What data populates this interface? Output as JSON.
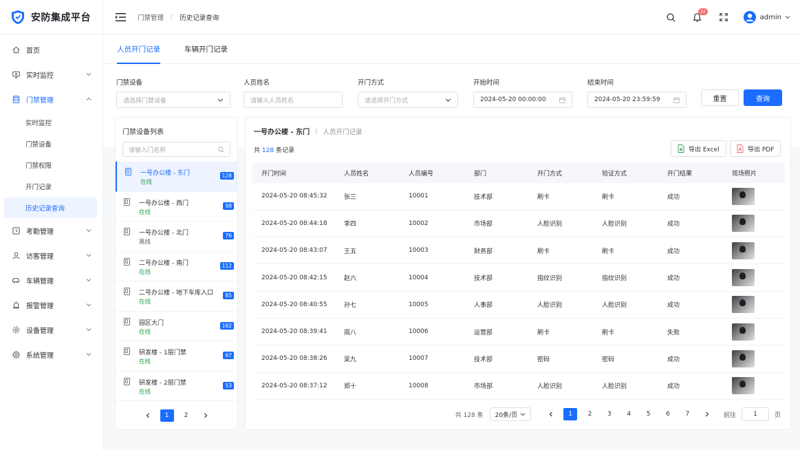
{
  "app": {
    "name": "安防集成平台"
  },
  "sidebar": {
    "items": [
      {
        "label": "首页",
        "icon": "home-icon"
      },
      {
        "label": "实时监控",
        "icon": "monitor-icon",
        "expandable": true
      },
      {
        "label": "门禁管理",
        "icon": "access-icon",
        "expandable": true,
        "open": true,
        "children": [
          "实时监控",
          "门禁设备",
          "门禁权限",
          "开门记录",
          "历史记录查询"
        ],
        "active_child": 4
      },
      {
        "label": "考勤管理",
        "icon": "attendance-icon",
        "expandable": true
      },
      {
        "label": "访客管理",
        "icon": "user-icon",
        "expandable": true
      },
      {
        "label": "车辆管理",
        "icon": "car-icon",
        "expandable": true
      },
      {
        "label": "报警管理",
        "icon": "alarm-icon",
        "expandable": true
      },
      {
        "label": "设备管理",
        "icon": "gear-icon",
        "expandable": true
      },
      {
        "label": "系统管理",
        "icon": "settings-icon",
        "expandable": true
      }
    ]
  },
  "header": {
    "breadcrumb": [
      "门禁管理",
      "历史记录查询"
    ],
    "notification_count": "32",
    "username": "admin"
  },
  "tabs": [
    {
      "label": "人员开门记录",
      "active": true
    },
    {
      "label": "车辆开门记录",
      "active": false
    }
  ],
  "filters": {
    "device": {
      "label": "门禁设备",
      "placeholder": "请选择门禁设备"
    },
    "person": {
      "label": "人员姓名",
      "placeholder": "请输入人员姓名"
    },
    "method": {
      "label": "开门方式",
      "placeholder": "请选择开门方式"
    },
    "start": {
      "label": "开始时间",
      "value": "2024-05-20 00:00:00"
    },
    "end": {
      "label": "结束时间",
      "value": "2024-05-20 23:59:59"
    },
    "reset_label": "重置",
    "query_label": "查询"
  },
  "device_panel": {
    "title": "门禁设备列表",
    "search_placeholder": "请输入门名称",
    "devices": [
      {
        "name": "一号办公楼 - 东门",
        "status": "在线",
        "count": "128",
        "active": true
      },
      {
        "name": "一号办公楼 - 西门",
        "status": "在线",
        "count": "98"
      },
      {
        "name": "一号办公楼 - 北门",
        "status": "离线",
        "count": "76"
      },
      {
        "name": "二号办公楼 - 南门",
        "status": "在线",
        "count": "112"
      },
      {
        "name": "二号办公楼 - 地下车库入口",
        "status": "在线",
        "count": "85"
      },
      {
        "name": "园区大门",
        "status": "在线",
        "count": "162"
      },
      {
        "name": "研发楼 - 1层门禁",
        "status": "在线",
        "count": "67"
      },
      {
        "name": "研发楼 - 2层门禁",
        "status": "在线",
        "count": "53"
      }
    ],
    "pages": [
      "1",
      "2"
    ],
    "current_page": "1"
  },
  "records": {
    "title": "一号办公楼 - 东门",
    "subtitle": "人员开门记录",
    "total_prefix": "共",
    "total": "128",
    "total_suffix": "条记录",
    "export_excel": "导出 Excel",
    "export_pdf": "导出 PDF",
    "columns": [
      "开门时间",
      "人员姓名",
      "人员编号",
      "部门",
      "开门方式",
      "验证方式",
      "开门结果",
      "现场照片"
    ],
    "rows": [
      [
        "2024-05-20 08:45:32",
        "张三",
        "10001",
        "技术部",
        "刷卡",
        "刷卡",
        "成功"
      ],
      [
        "2024-05-20 08:44:18",
        "李四",
        "10002",
        "市场部",
        "人脸识别",
        "人脸识别",
        "成功"
      ],
      [
        "2024-05-20 08:43:07",
        "王五",
        "10003",
        "财务部",
        "刷卡",
        "刷卡",
        "成功"
      ],
      [
        "2024-05-20 08:42:15",
        "赵六",
        "10004",
        "技术部",
        "指纹识别",
        "指纹识别",
        "成功"
      ],
      [
        "2024-05-20 08:40:55",
        "孙七",
        "10005",
        "人事部",
        "人脸识别",
        "人脸识别",
        "成功"
      ],
      [
        "2024-05-20 08:39:41",
        "周八",
        "10006",
        "运营部",
        "刷卡",
        "刷卡",
        "失败"
      ],
      [
        "2024-05-20 08:38:26",
        "吴九",
        "10007",
        "技术部",
        "密码",
        "密码",
        "成功"
      ],
      [
        "2024-05-20 08:37:12",
        "郑十",
        "10008",
        "市场部",
        "人脸识别",
        "人脸识别",
        "成功"
      ]
    ],
    "pager": {
      "total_text": "共 128 条",
      "page_size": "20条/页",
      "pages": [
        "1",
        "2",
        "3",
        "4",
        "5",
        "6",
        "7"
      ],
      "current_page": "1",
      "goto_label": "前往",
      "goto_value": "1",
      "page_unit": "页"
    }
  },
  "colors": {
    "accent": "#1a6dff",
    "success": "#2ca14e",
    "danger": "#f56c6c"
  }
}
